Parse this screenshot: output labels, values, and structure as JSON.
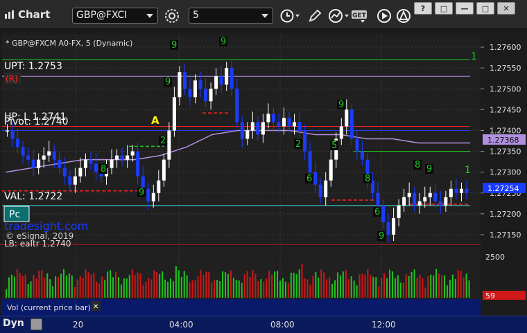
{
  "window": {
    "title": "Chart",
    "symbol": "GBP@FXCI",
    "interval": "5",
    "win_buttons": [
      "?",
      "□",
      "—",
      "□",
      "✕"
    ]
  },
  "toolbar": {
    "icons": [
      "settings-icon",
      "clock-icon",
      "pencil-icon",
      "study-icon",
      "get-icon",
      "play-icon",
      "alert-icon"
    ],
    "get_label": "GET"
  },
  "colors": {
    "background": "#202020",
    "up_candle": "#ffffff",
    "down_candle": "#1a3cff",
    "accent_green": "#22cc22",
    "pivot_red": "#ff2020",
    "uptline": "#b090e0",
    "val_line": "#40e0e0",
    "volume_green": "#1fc41f",
    "volume_red": "#d01818"
  },
  "price_panel": {
    "header": "* GBP@FXCM A0-FX, 5 (Dynamic)",
    "labels": {
      "upt": "UPT: 1.2753",
      "r": "(R)",
      "hp": "HP: L 1.2741",
      "pivot": "Pivot: 1.2740",
      "val": "VAL: 1.2722",
      "pc": "Pc",
      "watermark": "tradesight.com",
      "copyright": "© eSignal, 2019",
      "lbrealtr": "LB: eaItr 1.2740",
      "a_marker": "A"
    },
    "price_axis": [
      "1.27600",
      "1.27550",
      "1.27500",
      "1.27450",
      "1.27400",
      "1.27350",
      "1.27300",
      "1.27250",
      "1.27200",
      "1.27150"
    ],
    "ma_value": "1.27368",
    "last_value": "1.27254",
    "right_count_labels": [
      "1",
      "1"
    ]
  },
  "volume_panel": {
    "axis_label": "2500",
    "current_value": "59",
    "legend": "Vol (current price bar)",
    "close_label": "✕"
  },
  "bottom_bar": {
    "dyn_label": "Dyn",
    "time_labels": [
      "20",
      "04:00",
      "08:00",
      "12:00"
    ]
  },
  "chart_data": {
    "type": "candlestick",
    "title": "* GBP@FXCM A0-FX, 5 (Dynamic)",
    "ylim": [
      1.2713,
      1.2763
    ],
    "x_ticks": [
      "20",
      "04:00",
      "08:00",
      "12:00"
    ],
    "levels": {
      "UPT": 1.2753,
      "HP": 1.2741,
      "Pivot": 1.274,
      "VAL": 1.2722,
      "green_top": 1.2757,
      "green_mid": 1.2735
    },
    "series": [
      {
        "name": "price",
        "values": [
          1.274,
          1.2738,
          1.2736,
          1.2734,
          1.2733,
          1.2731,
          1.2733,
          1.2734,
          1.2735,
          1.2733,
          1.2731,
          1.2729,
          1.2727,
          1.2729,
          1.2731,
          1.2733,
          1.2732,
          1.273,
          1.2729,
          1.2731,
          1.2733,
          1.2734,
          1.2733,
          1.2734,
          1.2735,
          1.2729,
          1.2726,
          1.2723,
          1.2725,
          1.2728,
          1.2733,
          1.274,
          1.2748,
          1.2754,
          1.275,
          1.2748,
          1.2752,
          1.275,
          1.2747,
          1.275,
          1.2753,
          1.2751,
          1.2755,
          1.275,
          1.2742,
          1.2738,
          1.274,
          1.2742,
          1.2739,
          1.2742,
          1.2744,
          1.2742,
          1.2741,
          1.2743,
          1.2741,
          1.2742,
          1.274,
          1.2735,
          1.273,
          1.2727,
          1.2724,
          1.2728,
          1.2733,
          1.2738,
          1.2741,
          1.2745,
          1.2738,
          1.2735,
          1.2733,
          1.2728,
          1.2725,
          1.2722,
          1.2718,
          1.2715,
          1.2719,
          1.2722,
          1.2724,
          1.2725,
          1.2722,
          1.2723,
          1.2724,
          1.2725,
          1.2723,
          1.2722,
          1.2724,
          1.2726,
          1.2725,
          1.2726,
          1.2725
        ]
      },
      {
        "name": "moving-average",
        "values": [
          1.273,
          1.2731,
          1.2732,
          1.2733,
          1.2733,
          1.2733,
          1.2734,
          1.2736,
          1.2739,
          1.274,
          1.274,
          1.274,
          1.2739,
          1.2739,
          1.2738,
          1.2738,
          1.2737,
          1.2737,
          1.2737
        ]
      }
    ],
    "volume": {
      "axis": [
        0,
        2500
      ],
      "current": 59
    }
  }
}
